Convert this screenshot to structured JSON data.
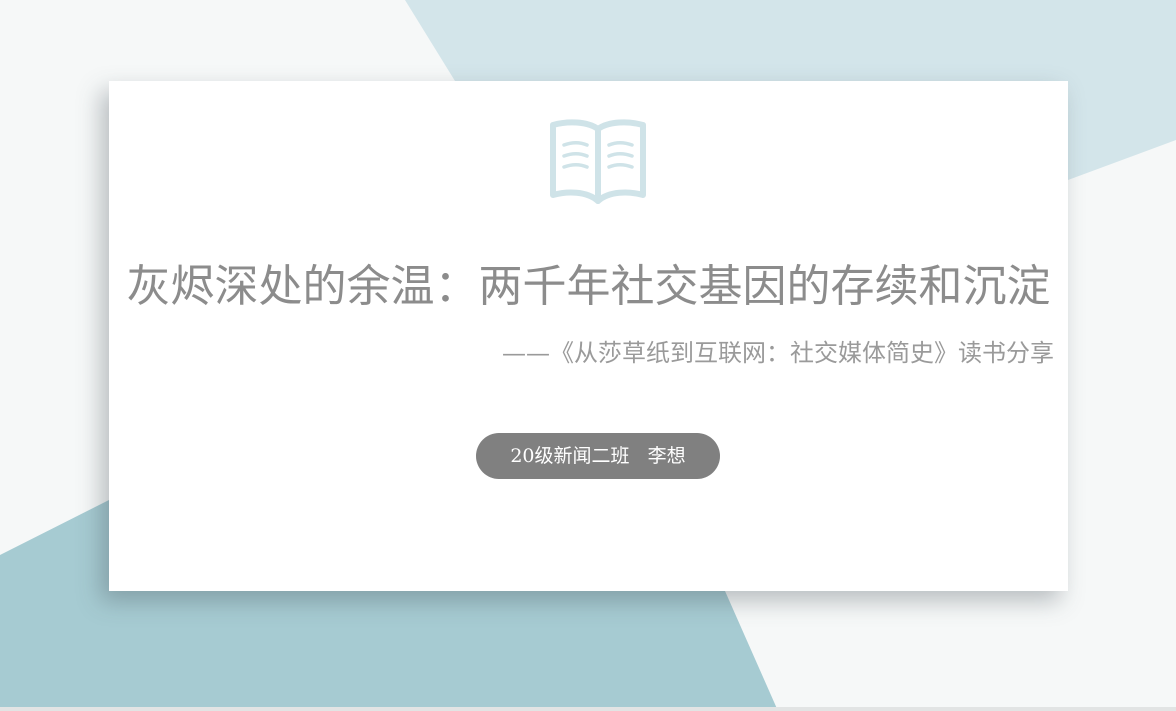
{
  "slide": {
    "title": "灰烬深处的余温：两千年社交基因的存续和沉淀",
    "subtitle": "——《从莎草纸到互联网：社交媒体简史》读书分享",
    "author": "20级新闻二班   李想",
    "icon": "open-book-icon"
  },
  "colors": {
    "background": "#f6f8f8",
    "accent_light_blue": "#d3e5ea",
    "accent_teal": "#a6cbd2",
    "card": "#ffffff",
    "title_text": "#8c8c8c",
    "subtitle_text": "#9a9a9a",
    "pill": "#808080",
    "pill_text": "#ffffff",
    "icon_stroke": "#cfe3e8"
  }
}
